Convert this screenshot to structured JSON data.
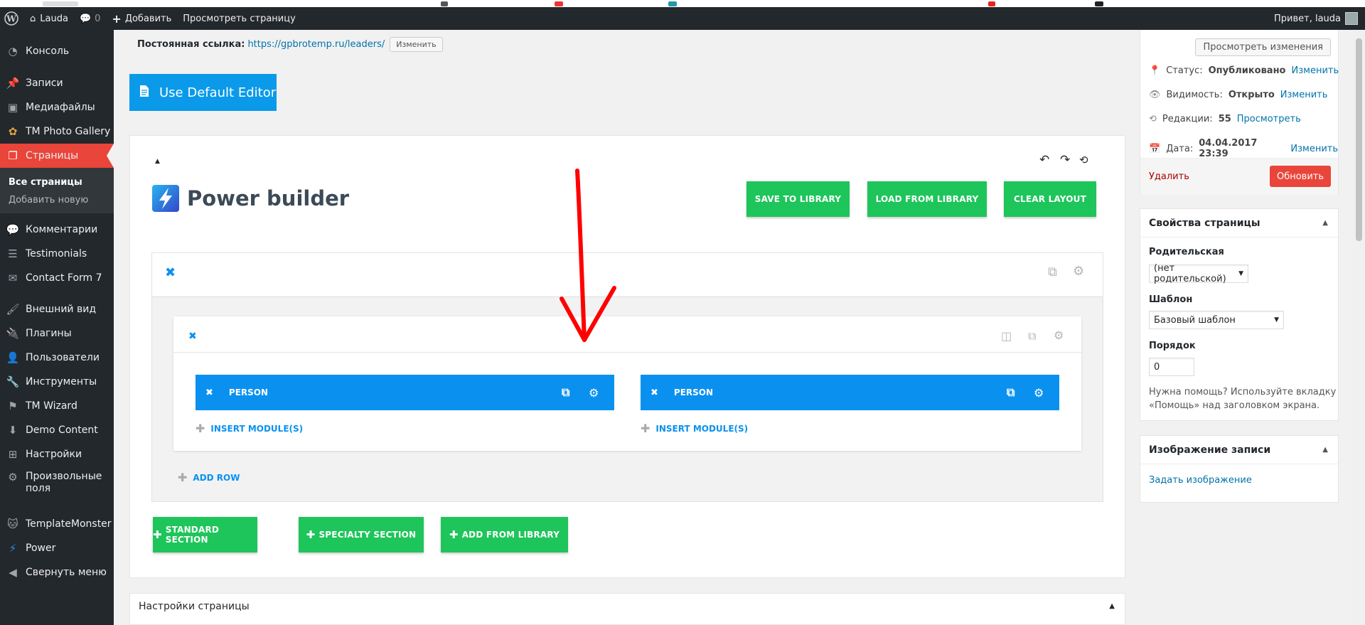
{
  "adminbar": {
    "site_name": "Lauda",
    "comments_count": "0",
    "add_label": "Добавить",
    "view_page_label": "Просмотреть страницу",
    "greeting": "Привет, lauda"
  },
  "sidebar": {
    "items": [
      {
        "label": "Консоль",
        "icon": "dashboard-icon"
      },
      {
        "label": "Записи",
        "icon": "pin-icon"
      },
      {
        "label": "Медиафайлы",
        "icon": "media-icon"
      },
      {
        "label": "TM Photo Gallery",
        "icon": "flower-icon"
      },
      {
        "label": "Страницы",
        "icon": "pages-icon"
      },
      {
        "label": "Комментарии",
        "icon": "comment-icon"
      },
      {
        "label": "Testimonials",
        "icon": "list-icon"
      },
      {
        "label": "Contact Form 7",
        "icon": "mail-icon"
      },
      {
        "label": "Внешний вид",
        "icon": "brush-icon"
      },
      {
        "label": "Плагины",
        "icon": "plugin-icon"
      },
      {
        "label": "Пользователи",
        "icon": "user-icon"
      },
      {
        "label": "Инструменты",
        "icon": "wrench-icon"
      },
      {
        "label": "TM Wizard",
        "icon": "flag-icon"
      },
      {
        "label": "Demo Content",
        "icon": "download-icon"
      },
      {
        "label": "Настройки",
        "icon": "settings-icon"
      },
      {
        "label": "Произвольные",
        "label2": "поля",
        "icon": "gear-icon"
      },
      {
        "label": "TemplateMonster",
        "icon": "tm-cat-icon"
      },
      {
        "label": "Power",
        "icon": "bolt-icon"
      },
      {
        "label": "Свернуть меню",
        "icon": "collapse-icon"
      }
    ],
    "submenu": [
      "Все страницы",
      "Добавить новую"
    ]
  },
  "permalink": {
    "label": "Постоянная ссылка:",
    "url": "https://gpbrotemp.ru/leaders/",
    "edit_button": "Изменить"
  },
  "default_editor_label": "Use Default Editor",
  "builder": {
    "title": "Power builder",
    "save_to_library": "SAVE TO LIBRARY",
    "load_from_library": "LOAD FROM LIBRARY",
    "clear_layout": "CLEAR LAYOUT",
    "modules": [
      {
        "name": "PERSON",
        "insert": "INSERT MODULE(S)"
      },
      {
        "name": "PERSON",
        "insert": "INSERT MODULE(S)"
      }
    ],
    "add_row": "ADD ROW",
    "standard_section": "STANDARD SECTION",
    "specialty_section": "SPECIALTY SECTION",
    "add_from_library": "ADD FROM LIBRARY"
  },
  "publish": {
    "preview_button": "Просмотреть изменения",
    "status_label": "Статус:",
    "status_value": "Опубликовано",
    "visibility_label": "Видимость:",
    "visibility_value": "Открыто",
    "revisions_label": "Редакции:",
    "revisions_value": "55",
    "revisions_link": "Просмотреть",
    "date_label": "Дата:",
    "date_value": "04.04.2017 23:39",
    "edit_link": "Изменить",
    "delete_link": "Удалить",
    "update_button": "Обновить"
  },
  "page_attributes": {
    "title": "Свойства страницы",
    "parent_label": "Родительская",
    "parent_value": "(нет родительской)",
    "template_label": "Шаблон",
    "template_value": "Базовый шаблон",
    "order_label": "Порядок",
    "order_value": "0",
    "help_text_1": "Нужна помощь? Используйте вкладку",
    "help_text_2": "«Помощь» над заголовком экрана."
  },
  "featured_image": {
    "title": "Изображение записи",
    "set_link": "Задать изображение"
  },
  "page_settings_title": "Настройки страницы",
  "colors": {
    "wp_dark": "#23282d",
    "accent_blue": "#0a91f0",
    "green": "#1ec55a",
    "active_red": "#e9453a",
    "update_red": "#e9453a",
    "annotation_red": "#ff0000"
  }
}
